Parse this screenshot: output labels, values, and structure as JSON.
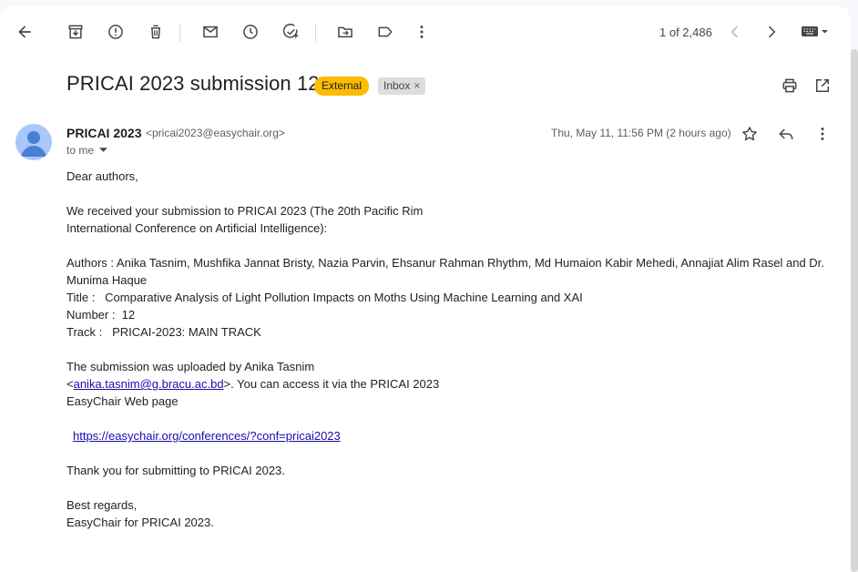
{
  "toolbar": {
    "icons": [
      "back-icon",
      "archive-icon",
      "report-spam-icon",
      "delete-icon",
      "mark-unread-icon",
      "snooze-icon",
      "add-task-icon",
      "move-to-icon",
      "label-icon",
      "more-icon"
    ],
    "pager": "1 of 2,486"
  },
  "email": {
    "subject": "PRICAI 2023 submission 12",
    "badge_external": "External",
    "badge_inbox": "Inbox",
    "badge_inbox_close": "×",
    "sender_name": "PRICAI 2023",
    "sender_email": "<pricai2023@easychair.org>",
    "to": "to me",
    "date": "Thu, May 11, 11:56 PM (2 hours ago)",
    "body": {
      "greeting": "Dear authors,",
      "line1": "We received your submission to PRICAI 2023 (The 20th Pacific Rim",
      "line2": "International Conference on Artificial Intelligence):",
      "authors": "Authors : Anika Tasnim, Mushfika Jannat Bristy, Nazia Parvin, Ehsanur Rahman Rhythm, Md Humaion Kabir Mehedi, Annajiat Alim Rasel and Dr. Munima Haque",
      "title_line": "Title :   Comparative Analysis of Light Pollution Impacts on Moths Using Machine Learning and XAI",
      "number_line": "Number :  12",
      "track_line": "Track :   PRICAI-2023: MAIN TRACK",
      "uploaded_line": "The submission was uploaded by Anika Tasnim",
      "lt": "<",
      "email_link": "anika.tasnim@g.bracu.ac.bd",
      "access_text": ">. You can access it via the PRICAI 2023",
      "web_page": "EasyChair Web page",
      "url": "https://easychair.org/conferences/?conf=pricai2023",
      "thanks": "Thank you for submitting to PRICAI 2023.",
      "regards": "Best regards,",
      "signature": "EasyChair for PRICAI 2023."
    }
  },
  "colors": {
    "external_badge": "#fbbc04",
    "avatar": "#a8c7fa",
    "avatar_figure": "#4a7fd4",
    "link": "#1a0dab"
  }
}
